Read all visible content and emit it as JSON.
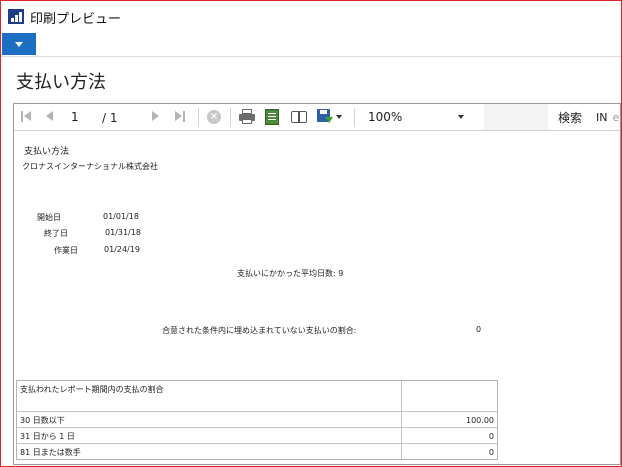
{
  "window": {
    "title": "印刷プレビュー"
  },
  "page": {
    "title": "支払い方法"
  },
  "viewer": {
    "current_page": "1",
    "total_pages": "/ 1",
    "zoom": "100%",
    "search_label": "検索",
    "find_text": "IN",
    "find_extra": "e"
  },
  "report": {
    "title": "支払い方法",
    "company": "クロナスインターナショナル株式会社",
    "start_date_label": "開始日",
    "start_date": "01/01/18",
    "end_date_label": "終了日",
    "end_date": "01/31/18",
    "work_date_label": "作業日",
    "work_date": "01/24/19",
    "avg_days_text": "支払いにかかった平均日数: 9",
    "pct_label": "合意された条件内に埋め込まれていない支払いの割合:",
    "pct_value": "0",
    "table": {
      "header": "支払われたレポート期間内の支払の割合",
      "rows": [
        {
          "label": "30 日数以下",
          "value": "100.00"
        },
        {
          "label": "31 日から 1 日",
          "value": "0"
        },
        {
          "label": "81 日または数手",
          "value": "0"
        }
      ]
    }
  },
  "colors": {
    "accent": "#1b6ec2",
    "window_border": "#d8262b"
  }
}
